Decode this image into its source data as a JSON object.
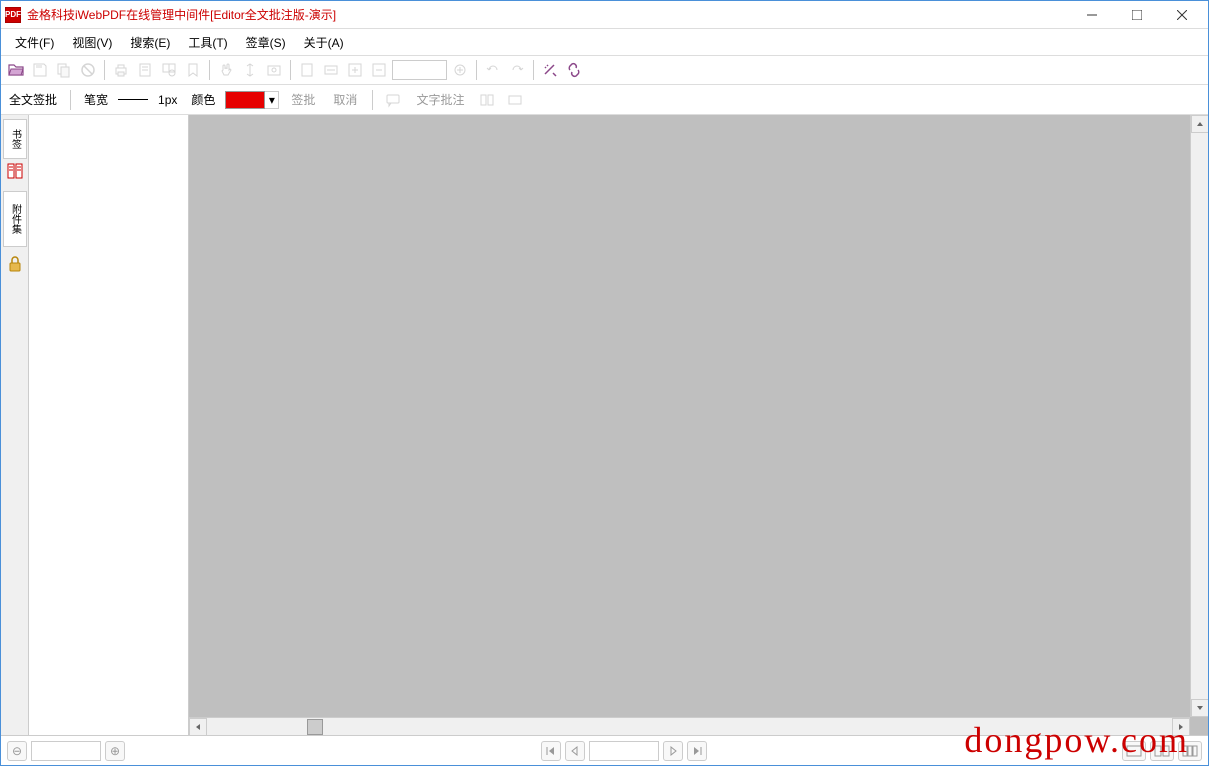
{
  "titlebar": {
    "app_icon_text": "PDF",
    "title": "金格科技iWebPDF在线管理中间件[Editor全文批注版-演示]"
  },
  "menu": {
    "file": "文件(F)",
    "view": "视图(V)",
    "search": "搜索(E)",
    "tools": "工具(T)",
    "stamp": "签章(S)",
    "about": "关于(A)"
  },
  "toolbar2": {
    "full_sign": "全文签批",
    "pen_width_label": "笔宽",
    "pen_width_value": "1px",
    "color_label": "颜色",
    "color_value": "#e60000",
    "sign": "签批",
    "cancel": "取消",
    "text_annot": "文字批注"
  },
  "side_tabs": {
    "bookmark": "书签",
    "attachment": "附件集"
  },
  "statusbar": {
    "zoom_out": "⊖",
    "zoom_in": "⊕"
  },
  "watermark": "dongpow.com"
}
